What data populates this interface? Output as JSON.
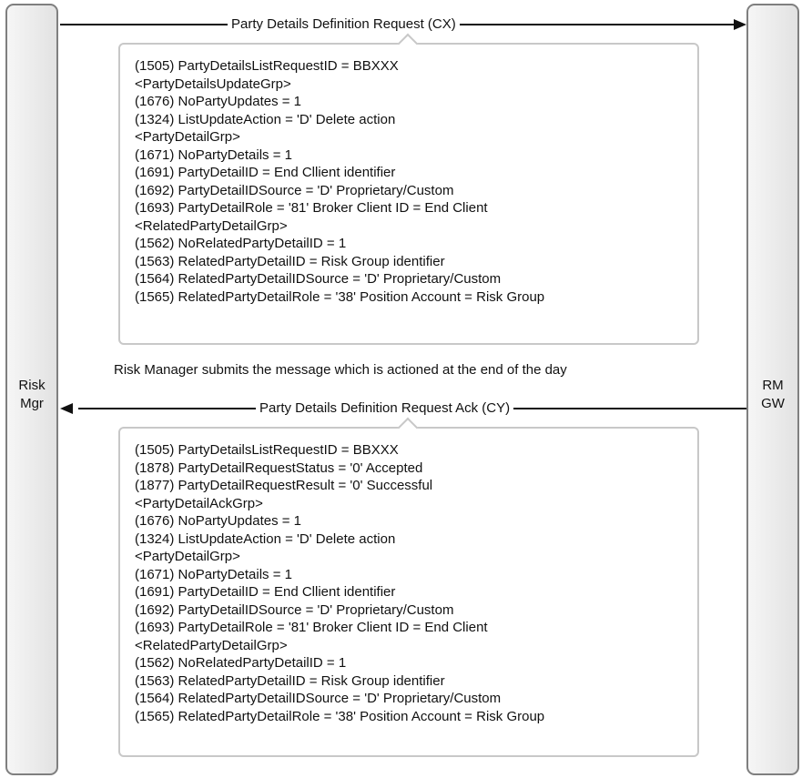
{
  "lanes": {
    "left": [
      "Risk",
      "Mgr"
    ],
    "right": [
      "RM",
      "GW"
    ]
  },
  "request": {
    "label": "Party Details Definition Request (CX)",
    "lines": [
      "(1505) PartyDetailsListRequestID = BBXXX",
      "<PartyDetailsUpdateGrp>",
      "(1676) NoPartyUpdates = 1",
      "(1324) ListUpdateAction = 'D' Delete action",
      "<PartyDetailGrp>",
      "(1671) NoPartyDetails = 1",
      "(1691) PartyDetailID = End Cllient identifier",
      "(1692) PartyDetailIDSource = 'D' Proprietary/Custom",
      "(1693) PartyDetailRole = '81' Broker Client ID = End Client",
      "<RelatedPartyDetailGrp>",
      "(1562) NoRelatedPartyDetailID = 1",
      "(1563) RelatedPartyDetailID = Risk Group identifier",
      "(1564) RelatedPartyDetailIDSource = 'D' Proprietary/Custom",
      "(1565) RelatedPartyDetailRole = '38' Position Account = Risk Group"
    ]
  },
  "note": "Risk Manager submits the message which is actioned at the end of the day",
  "ack": {
    "label": "Party Details Definition Request Ack (CY)",
    "lines": [
      "(1505) PartyDetailsListRequestID = BBXXX",
      "(1878) PartyDetailRequestStatus = '0' Accepted",
      "(1877) PartyDetailRequestResult = '0' Successful",
      "<PartyDetailAckGrp>",
      "(1676) NoPartyUpdates = 1",
      "(1324) ListUpdateAction = 'D' Delete action",
      "<PartyDetailGrp>",
      "(1671) NoPartyDetails = 1",
      "(1691) PartyDetailID = End Cllient identifier",
      "(1692) PartyDetailIDSource = 'D' Proprietary/Custom",
      "(1693) PartyDetailRole = '81' Broker Client ID = End Client",
      "<RelatedPartyDetailGrp>",
      "(1562) NoRelatedPartyDetailID = 1",
      "(1563) RelatedPartyDetailID = Risk Group identifier",
      "(1564) RelatedPartyDetailIDSource = 'D' Proprietary/Custom",
      "(1565) RelatedPartyDetailRole = '38' Position Account = Risk Group"
    ]
  }
}
